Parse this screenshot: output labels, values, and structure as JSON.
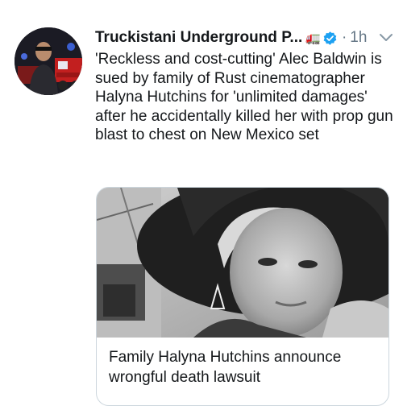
{
  "tweet": {
    "author_name": "Truckistani Underground P...",
    "author_emoji": "🚛",
    "time": "1h",
    "separator": "·",
    "text": "'Reckless and cost-cutting' Alec Baldwin is sued by family of Rust cinematographer Halyna Hutchins for 'unlimited damages' after he accidentally killed her with prop gun blast to chest on New Mexico set",
    "card": {
      "title": "Family Halyna Hutchins announce wrongful death lawsuit"
    }
  },
  "icons": {
    "verified": "verified-badge-icon",
    "menu": "chevron-down-icon"
  },
  "colors": {
    "verified_blue": "#1da1f2",
    "muted_text": "#657786",
    "border": "#ccd6dd"
  }
}
